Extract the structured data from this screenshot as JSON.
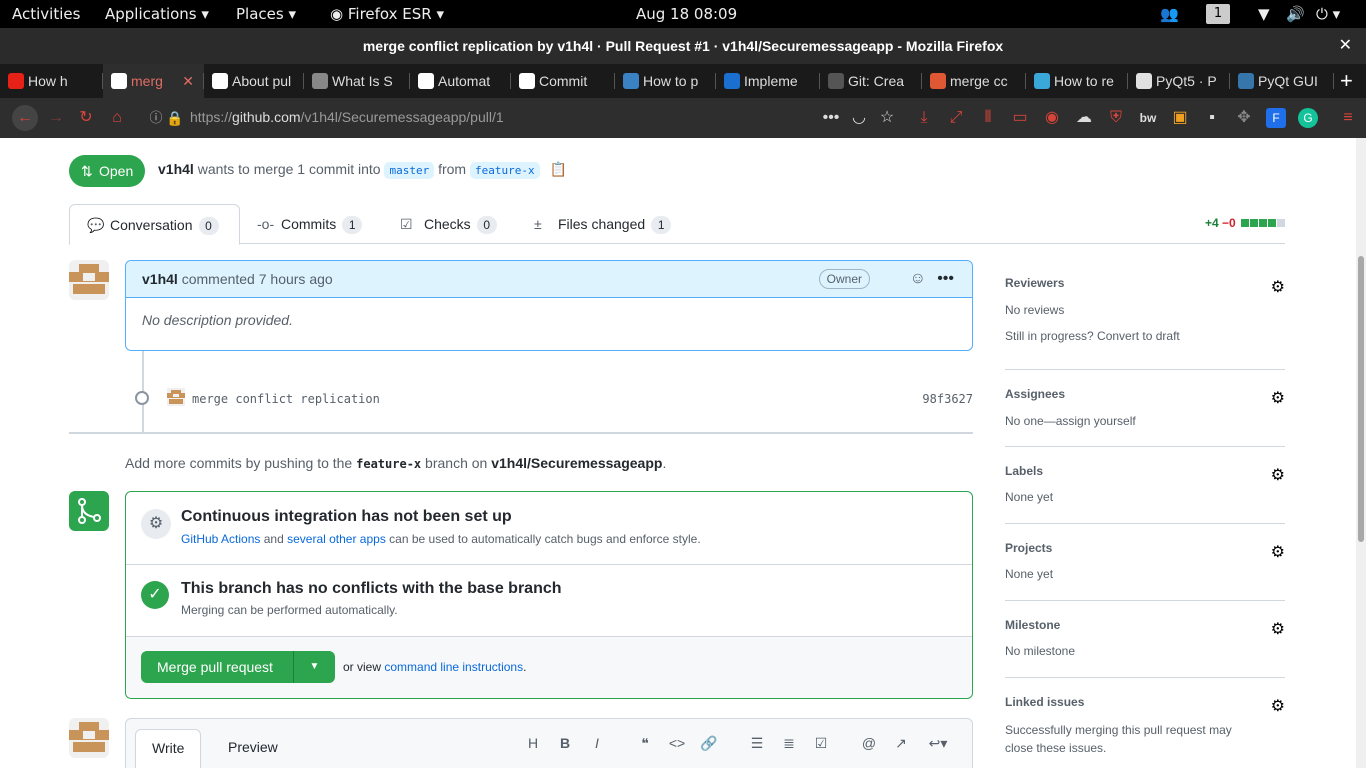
{
  "system": {
    "activities": "Activities",
    "applications": "Applications",
    "places": "Places",
    "browser_app": "Firefox ESR",
    "clock": "Aug 18  08:09",
    "workspace": "1"
  },
  "window": {
    "title": "merge conflict replication by v1h4l · Pull Request #1 · v1h4l/Securemessageapp - Mozilla Firefox"
  },
  "browser_tabs": [
    {
      "label": "How h",
      "color": "#e62117"
    },
    {
      "label": "merg",
      "color": "#ffffff",
      "active": true
    },
    {
      "label": "About pul",
      "color": "#ffffff"
    },
    {
      "label": "What Is S",
      "color": "#888888"
    },
    {
      "label": "Automat",
      "color": "#ffffff"
    },
    {
      "label": "Commit",
      "color": "#ffffff"
    },
    {
      "label": "How to p",
      "color": "#3b82c4"
    },
    {
      "label": "Impleme",
      "color": "#1a6fd1"
    },
    {
      "label": "Git: Crea",
      "color": "#555555"
    },
    {
      "label": "merge cc",
      "color": "#de5833"
    },
    {
      "label": "How to re",
      "color": "#3aa9d9"
    },
    {
      "label": "PyQt5 · P",
      "color": "#e0e0e0"
    },
    {
      "label": "PyQt GUI",
      "color": "#3776ab"
    }
  ],
  "url": {
    "prefix": "https://",
    "host": "github.com",
    "path": "/v1h4l/Securemessageapp/pull/1"
  },
  "pr": {
    "state": "Open",
    "author": "v1h4l",
    "meta_text": "wants to merge 1 commit into",
    "base": "master",
    "from_text": "from",
    "head": "feature-x",
    "tabs": [
      {
        "label": "Conversation",
        "count": "0"
      },
      {
        "label": "Commits",
        "count": "1"
      },
      {
        "label": "Checks",
        "count": "0"
      },
      {
        "label": "Files changed",
        "count": "1"
      }
    ],
    "additions": "+4",
    "deletions": "−0"
  },
  "comment": {
    "author": "v1h4l",
    "action": "commented 7 hours ago",
    "badge": "Owner",
    "body": "No description provided."
  },
  "commit": {
    "message": "merge conflict replication",
    "sha": "98f3627"
  },
  "push_hint": {
    "prefix": "Add more commits by pushing to the",
    "branch": "feature-x",
    "middle": "branch on",
    "repo": "v1h4l/Securemessageapp",
    "suffix": "."
  },
  "merge_box": {
    "ci_title": "Continuous integration has not been set up",
    "ci_link1": "GitHub Actions",
    "ci_and": "and",
    "ci_link2": "several other apps",
    "ci_rest": "can be used to automatically catch bugs and enforce style.",
    "conflict_title": "This branch has no conflicts with the base branch",
    "conflict_sub": "Merging can be performed automatically.",
    "merge_button": "Merge pull request",
    "or_view": "or view",
    "cli_link": "command line instructions",
    "period": "."
  },
  "sidebar": {
    "reviewers": {
      "title": "Reviewers",
      "value": "No reviews",
      "extra": "Still in progress? Convert to draft"
    },
    "assignees": {
      "title": "Assignees",
      "value": "No one—assign yourself"
    },
    "labels": {
      "title": "Labels",
      "value": "None yet"
    },
    "projects": {
      "title": "Projects",
      "value": "None yet"
    },
    "milestone": {
      "title": "Milestone",
      "value": "No milestone"
    },
    "linked": {
      "title": "Linked issues",
      "value": "Successfully merging this pull request may close these issues."
    }
  },
  "composer": {
    "write": "Write",
    "preview": "Preview"
  }
}
